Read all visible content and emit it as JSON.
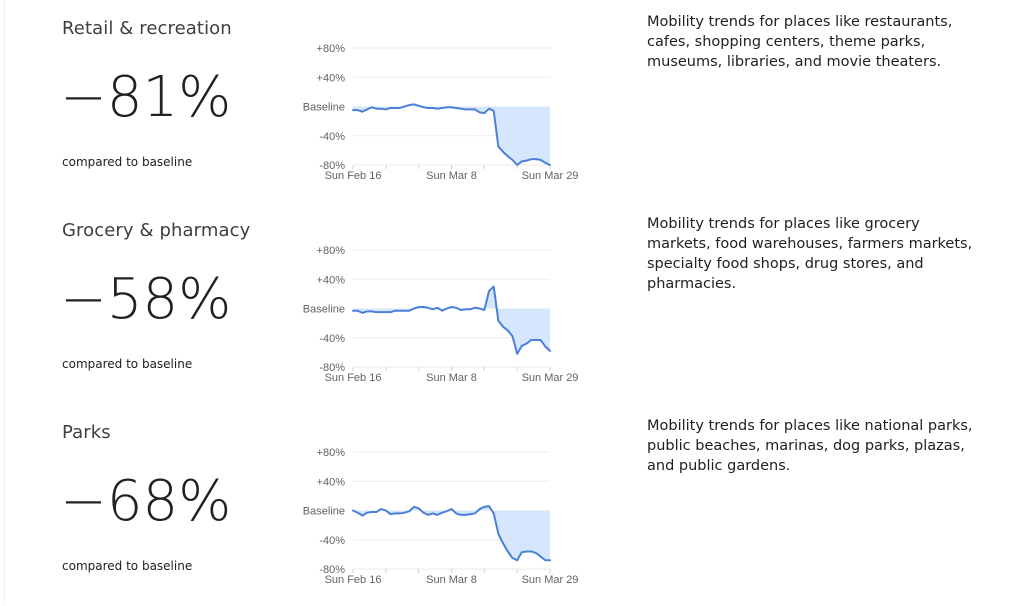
{
  "sections": [
    {
      "title": "Retail & recreation",
      "value": "-81%",
      "compared_label": "compared to baseline",
      "description": "Mobility trends for places like restaurants, cafes, shopping centers, theme parks, museums, libraries, and movie theaters."
    },
    {
      "title": "Grocery & pharmacy",
      "value": "-58%",
      "compared_label": "compared to baseline",
      "description": "Mobility trends for places like grocery markets, food warehouses, farmers markets, specialty food shops, drug stores, and pharmacies."
    },
    {
      "title": "Parks",
      "value": "-68%",
      "compared_label": "compared to baseline",
      "description": "Mobility trends for places like national parks, public beaches, marinas, dog parks, plazas, and public gardens."
    }
  ],
  "colors": {
    "line": "#4a80d9",
    "fill": "#d2e3fc",
    "grid": "#ebebeb",
    "axis_text": "#5f6368"
  },
  "chart_data": [
    {
      "type": "area",
      "title": "Retail & recreation",
      "xlabel": "",
      "ylabel": "",
      "x_start": "Sun Feb 16",
      "x_end": "Sun Mar 29",
      "x_ticks": [
        "Sun Feb 16",
        "Sun Mar 8",
        "Sun Mar 29"
      ],
      "y_ticks": [
        "+80%",
        "+40%",
        "Baseline",
        "-40%",
        "-80%"
      ],
      "ylim": [
        -80,
        80
      ],
      "grid": true,
      "values": [
        -5,
        -5,
        -7,
        -4,
        -1,
        -3,
        -3,
        -4,
        -2,
        -2,
        -2,
        0,
        2,
        3,
        1,
        -1,
        -2,
        -2,
        -3,
        -2,
        -1,
        -1,
        -2,
        -3,
        -4,
        -4,
        -4,
        -8,
        -9,
        -3,
        -6,
        -55,
        -62,
        -68,
        -73,
        -80,
        -75,
        -74,
        -72,
        -72,
        -73,
        -77,
        -80
      ]
    },
    {
      "type": "area",
      "title": "Grocery & pharmacy",
      "xlabel": "",
      "ylabel": "",
      "x_start": "Sun Feb 16",
      "x_end": "Sun Mar 29",
      "x_ticks": [
        "Sun Feb 16",
        "Sun Mar 8",
        "Sun Mar 29"
      ],
      "y_ticks": [
        "+80%",
        "+40%",
        "Baseline",
        "-40%",
        "-80%"
      ],
      "ylim": [
        -80,
        80
      ],
      "grid": true,
      "values": [
        -3,
        -3,
        -6,
        -4,
        -4,
        -5,
        -5,
        -5,
        -5,
        -3,
        -3,
        -3,
        -3,
        0,
        2,
        2,
        1,
        -1,
        1,
        -3,
        0,
        2,
        1,
        -2,
        -1,
        -1,
        1,
        0,
        -2,
        24,
        30,
        -17,
        -25,
        -30,
        -38,
        -62,
        -51,
        -48,
        -43,
        -43,
        -43,
        -52,
        -58
      ]
    },
    {
      "type": "area",
      "title": "Parks",
      "xlabel": "",
      "ylabel": "",
      "x_start": "Sun Feb 16",
      "x_end": "Sun Mar 29",
      "x_ticks": [
        "Sun Feb 16",
        "Sun Mar 8",
        "Sun Mar 29"
      ],
      "y_ticks": [
        "+80%",
        "+40%",
        "Baseline",
        "-40%",
        "-80%"
      ],
      "ylim": [
        -80,
        80
      ],
      "grid": true,
      "values": [
        0,
        -3,
        -7,
        -3,
        -2,
        -2,
        2,
        0,
        -5,
        -4,
        -4,
        -3,
        -1,
        5,
        3,
        -3,
        -6,
        -4,
        -6,
        -3,
        -1,
        2,
        -4,
        -6,
        -6,
        -5,
        -4,
        2,
        5,
        6,
        -4,
        -32,
        -45,
        -56,
        -65,
        -68,
        -57,
        -56,
        -56,
        -58,
        -63,
        -68,
        -68
      ]
    }
  ]
}
